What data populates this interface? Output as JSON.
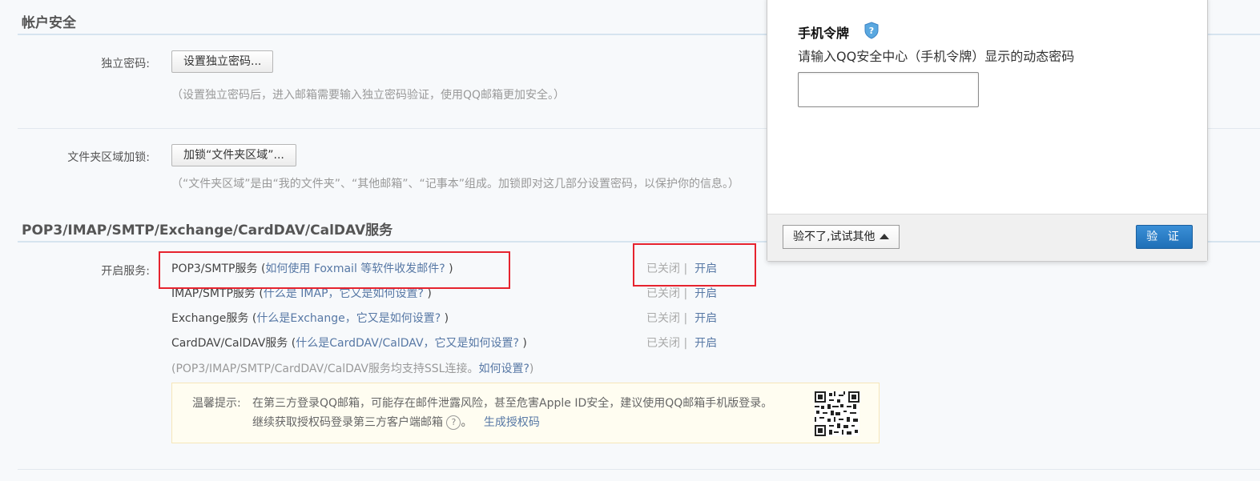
{
  "account_security": {
    "title": "帐户安全",
    "independent_password": {
      "label": "独立密码:",
      "button": "设置独立密码...",
      "hint": "（设置独立密码后，进入邮箱需要输入独立密码验证，使用QQ邮箱更加安全。）"
    },
    "folder_lock": {
      "label": "文件夹区域加锁:",
      "button": "加锁“文件夹区域”...",
      "hint": "（“文件夹区域”是由“我的文件夹”、“其他邮箱”、“记事本”组成。加锁即对这几部分设置密码，以保护你的信息。）"
    }
  },
  "services": {
    "title": "POP3/IMAP/SMTP/Exchange/CardDAV/CalDAV服务",
    "label": "开启服务:",
    "items": [
      {
        "name": "POP3/SMTP服务",
        "help": "如何使用 Foxmail 等软件收发邮件?",
        "status": "已关闭",
        "action": "开启"
      },
      {
        "name": "IMAP/SMTP服务",
        "help": "什么是 IMAP，它又是如何设置?",
        "status": "已关闭",
        "action": "开启"
      },
      {
        "name": "Exchange服务",
        "help": "什么是Exchange，它又是如何设置?",
        "status": "已关闭",
        "action": "开启"
      },
      {
        "name": "CardDAV/CalDAV服务",
        "help": "什么是CardDAV/CalDAV，它又是如何设置?",
        "status": "已关闭",
        "action": "开启"
      }
    ],
    "ssl_note_prefix": "(POP3/IMAP/SMTP/CardDAV/CalDAV服务均支持SSL连接。",
    "ssl_note_link": "如何设置?",
    "ssl_note_suffix": ")",
    "tip": {
      "label": "温馨提示:",
      "line1": "在第三方登录QQ邮箱，可能存在邮件泄露风险，甚至危害Apple ID安全，建议使用QQ邮箱手机版登录。",
      "line2": "继续获取授权码登录第三方客户端邮箱",
      "line2_end": "。",
      "generate_link": "生成授权码"
    }
  },
  "dialog": {
    "title": "手机令牌",
    "description": "请输入QQ安全中心（手机令牌）显示的动态密码",
    "input_value": "",
    "alt_button": "验不了,试试其他",
    "verify_button": "验 证"
  },
  "colors": {
    "link": "#5778a5",
    "highlight_box": "#e6232e",
    "verify_button": "#2a7fc9"
  }
}
